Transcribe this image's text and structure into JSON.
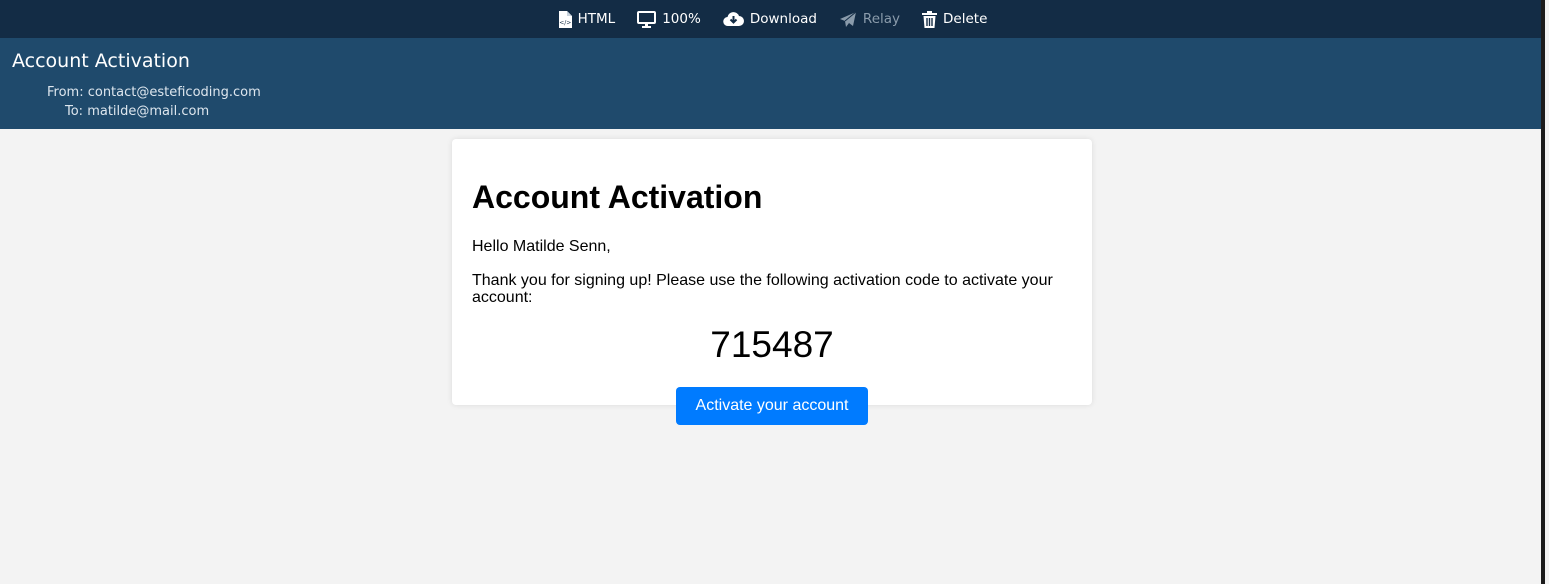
{
  "toolbar": {
    "html_label": "HTML",
    "zoom_label": "100%",
    "download_label": "Download",
    "relay_label": "Relay",
    "delete_label": "Delete",
    "icons": {
      "html": "html-file-icon",
      "zoom": "monitor-icon",
      "download": "cloud-download-icon",
      "relay": "send-icon",
      "delete": "trash-icon"
    }
  },
  "header": {
    "subject": "Account Activation",
    "from": "From: contact@esteficoding.com",
    "to": "To: matilde@mail.com"
  },
  "email": {
    "heading": "Account Activation",
    "greeting": "Hello Matilde Senn,",
    "message": "Thank you for signing up! Please use the following activation code to activate your account:",
    "code": "715487",
    "button_label": "Activate your account"
  },
  "colors": {
    "toolbar_bg": "#132c45",
    "header_bg": "#1f4a6c",
    "page_bg": "#f3f3f3",
    "button_bg": "#007bff"
  }
}
